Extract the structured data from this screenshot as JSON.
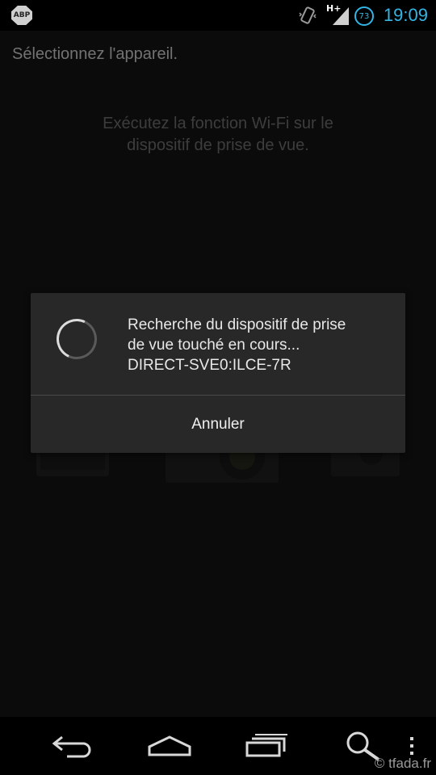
{
  "status_bar": {
    "adblock_label": "ABP",
    "network_label": "H+",
    "battery_level": "73",
    "time": "19:09",
    "accent_color": "#33b5e5"
  },
  "screen": {
    "title": "Sélectionnez l'appareil.",
    "instruction_line1": "Exécutez la fonction Wi-Fi sur le",
    "instruction_line2": "dispositif de prise de vue."
  },
  "dialog": {
    "message_line1": "Recherche du dispositif de prise",
    "message_line2": "de vue touché en cours...",
    "message_line3": "DIRECT-SVE0:ILCE-7R",
    "cancel_label": "Annuler"
  },
  "nav_bar": {
    "icons": [
      "back-icon",
      "home-icon",
      "recent-apps-icon",
      "search-icon",
      "overflow-menu-icon"
    ]
  },
  "watermark": "© tfada.fr"
}
